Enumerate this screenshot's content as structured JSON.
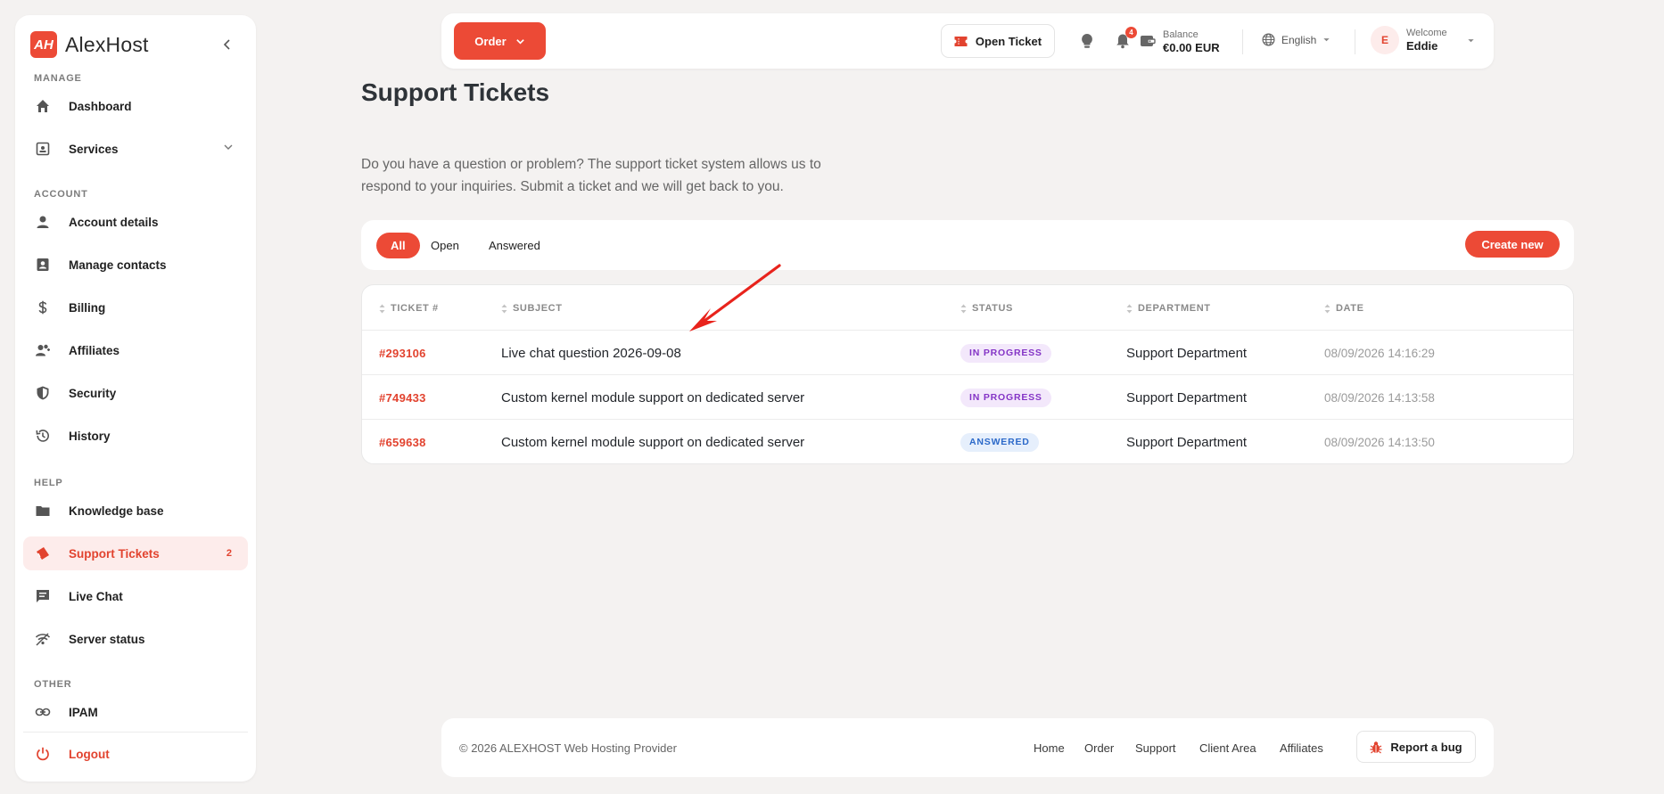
{
  "brand": {
    "logo_mark": "AH",
    "name": "AlexHost",
    "accent": "#ec4a36"
  },
  "sidebar": {
    "sections": {
      "manage": "MANAGE",
      "account": "ACCOUNT",
      "help": "HELP",
      "other": "OTHER"
    },
    "items": [
      {
        "label": "Dashboard",
        "icon": "home-icon"
      },
      {
        "label": "Services",
        "icon": "services-icon"
      },
      {
        "label": "Account details",
        "icon": "user-icon"
      },
      {
        "label": "Manage contacts",
        "icon": "contacts-icon"
      },
      {
        "label": "Billing",
        "icon": "dollar-icon"
      },
      {
        "label": "Affiliates",
        "icon": "affiliates-icon"
      },
      {
        "label": "Security",
        "icon": "shield-icon"
      },
      {
        "label": "History",
        "icon": "history-icon"
      },
      {
        "label": "Knowledge base",
        "icon": "folder-icon"
      },
      {
        "label": "Support Tickets",
        "icon": "ticket-icon",
        "badge": "2",
        "active": true
      },
      {
        "label": "Live Chat",
        "icon": "chat-icon"
      },
      {
        "label": "Server status",
        "icon": "signal-icon"
      },
      {
        "label": "IPAM",
        "icon": "link-icon"
      },
      {
        "label": "Logout",
        "icon": "power-icon"
      }
    ]
  },
  "topbar": {
    "order_label": "Order",
    "open_ticket_label": "Open Ticket",
    "notification_count": "4",
    "balance_label": "Balance",
    "balance_value": "€0.00 EUR",
    "language": "English",
    "avatar_initial": "E",
    "welcome_label": "Welcome",
    "user_name": "Eddie"
  },
  "main": {
    "title": "Support Tickets",
    "intro_line1": "Do you have a question or problem? The support ticket system allows us to",
    "intro_line2": "respond to your inquiries. Submit a ticket and we will get back to you.",
    "filters": [
      "All",
      "Open",
      "Answered"
    ],
    "active_filter": "All",
    "create_label": "Create new",
    "table": {
      "columns": [
        "TICKET #",
        "SUBJECT",
        "STATUS",
        "DEPARTMENT",
        "DATE"
      ],
      "rows": [
        {
          "id": "#293106",
          "subject": "Live chat question 2026-09-08",
          "status": "IN PROGRESS",
          "department": "Support Department",
          "date": "08/09/2026 14:16:29"
        },
        {
          "id": "#749433",
          "subject": "Custom kernel module support on dedicated server",
          "status": "IN PROGRESS",
          "department": "Support Department",
          "date": "08/09/2026 14:13:58"
        },
        {
          "id": "#659638",
          "subject": "Custom kernel module support on dedicated server",
          "status": "ANSWERED",
          "department": "Support Department",
          "date": "08/09/2026 14:13:50"
        }
      ]
    }
  },
  "footer": {
    "copyright": "© 2026 ALEXHOST Web Hosting Provider",
    "links": [
      "Home",
      "Order",
      "Support",
      "Client Area",
      "Affiliates"
    ],
    "report_bug_label": "Report a bug"
  },
  "colors": {
    "accent": "#ec4a36",
    "status_in_progress": "#8434c6",
    "status_answered": "#2c69c9"
  }
}
